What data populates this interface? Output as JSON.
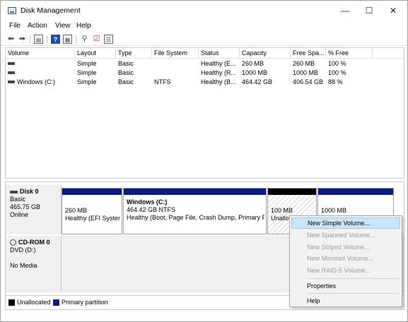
{
  "window": {
    "title": "Disk Management",
    "controls": {
      "minimize": "—",
      "maximize": "☐",
      "close": "✕"
    }
  },
  "menu": [
    "File",
    "Action",
    "View",
    "Help"
  ],
  "toolbar": {
    "icons": [
      "back-arrow-icon",
      "forward-arrow-icon",
      "console-tree-icon",
      "help-icon",
      "properties-icon",
      "connect-icon",
      "checkmark-icon",
      "list-icon"
    ]
  },
  "volume_list": {
    "columns": [
      "Volume",
      "Layout",
      "Type",
      "File System",
      "Status",
      "Capacity",
      "Free Spa...",
      "% Free"
    ],
    "rows": [
      {
        "volume": "",
        "layout": "Simple",
        "type": "Basic",
        "fs": "",
        "status": "Healthy (E...",
        "capacity": "260 MB",
        "free": "260 MB",
        "pct": "100 %"
      },
      {
        "volume": "",
        "layout": "Simple",
        "type": "Basic",
        "fs": "",
        "status": "Healthy (R...",
        "capacity": "1000 MB",
        "free": "1000 MB",
        "pct": "100 %"
      },
      {
        "volume": "Windows (C:)",
        "layout": "Simple",
        "type": "Basic",
        "fs": "NTFS",
        "status": "Healthy (B...",
        "capacity": "464.42 GB",
        "free": "406.54 GB",
        "pct": "88 %"
      }
    ]
  },
  "disks": {
    "disk0": {
      "name": "Disk 0",
      "type": "Basic",
      "size": "465.75 GB",
      "state": "Online",
      "partitions": [
        {
          "name": "",
          "size": "260 MB",
          "status": "Healthy (EFI System"
        },
        {
          "name": "Windows  (C:)",
          "size": "464.42 GB NTFS",
          "status": "Healthy (Boot, Page File, Crash Dump, Primary P"
        },
        {
          "name": "",
          "size": "100 MB",
          "status": "Unallo"
        },
        {
          "name": "",
          "size": "1000 MB",
          "status": ""
        }
      ]
    },
    "cdrom0": {
      "name": "CD-ROM 0",
      "type": "DVD (D:)",
      "state": "No Media"
    }
  },
  "legend": {
    "unallocated": "Unallocated",
    "primary": "Primary partition"
  },
  "colors": {
    "primary": "#0a1c83",
    "unallocated": "#000000",
    "highlight": "#cce4f7"
  },
  "context_menu": {
    "items": [
      {
        "label": "New Simple Volume...",
        "enabled": true
      },
      {
        "label": "New Spanned Volume...",
        "enabled": false
      },
      {
        "label": "New Striped Volume...",
        "enabled": false
      },
      {
        "label": "New Mirrored Volume...",
        "enabled": false
      },
      {
        "label": "New RAID-5 Volume...",
        "enabled": false
      },
      {
        "label": "Properties",
        "enabled": true
      },
      {
        "label": "Help",
        "enabled": true
      }
    ]
  }
}
